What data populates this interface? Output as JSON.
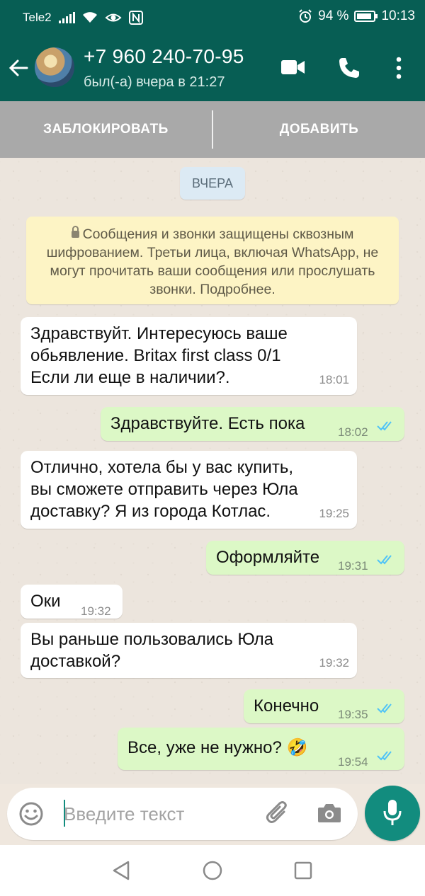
{
  "status_bar": {
    "carrier": "Tele2",
    "battery_percent": "94 %",
    "time": "10:13",
    "icons": [
      "signal-icon",
      "wifi-icon",
      "eye-icon",
      "nfc-icon",
      "alarm-icon",
      "battery-icon"
    ]
  },
  "header": {
    "contact_name": "+7 960 240-70-95",
    "last_seen": "был(-а) вчера в 21:27",
    "icons": [
      "back-arrow-icon",
      "video-call-icon",
      "phone-icon",
      "more-vert-icon"
    ]
  },
  "actions": {
    "block": "ЗАБЛОКИРОВАТЬ",
    "add": "ДОБАВИТЬ"
  },
  "chat": {
    "date_label": "ВЧЕРА",
    "encryption_notice": "Сообщения и звонки защищены сквозным шифрованием. Третьи лица, включая WhatsApp, не могут прочитать ваши сообщения или прослушать звонки. Подробнее.",
    "messages": [
      {
        "direction": "in",
        "text": "Здравствуйт. Интересуюсь ваше\nобьявление. Britax first class 0/1\nЕсли ли еще в наличии?.",
        "time": "18:01"
      },
      {
        "direction": "out",
        "text": "Здравствуйте. Есть пока",
        "time": "18:02",
        "status": "read"
      },
      {
        "direction": "in",
        "text": "Отлично, хотела бы у вас купить,\nвы сможете отправить через Юла\nдоставку? Я из города Котлас.",
        "time": "19:25"
      },
      {
        "direction": "out",
        "text": "Оформляйте",
        "time": "19:31",
        "status": "read"
      },
      {
        "direction": "in",
        "text": "Оки",
        "time": "19:32"
      },
      {
        "direction": "in",
        "text": "Вы раньше пользовались Юла\nдоставкой?",
        "time": "19:32"
      },
      {
        "direction": "out",
        "text": "Конечно",
        "time": "19:35",
        "status": "read"
      },
      {
        "direction": "out",
        "text": "Все, уже не нужно? 🤣",
        "time": "19:54",
        "status": "read"
      }
    ]
  },
  "input": {
    "placeholder": "Введите текст",
    "icons": [
      "emoji-icon",
      "attach-icon",
      "camera-icon",
      "mic-icon"
    ]
  },
  "colors": {
    "header": "#075e54",
    "accent": "#128c7e",
    "outgoing_bubble": "#dcf8c6",
    "read_tick": "#4fc3f7"
  }
}
